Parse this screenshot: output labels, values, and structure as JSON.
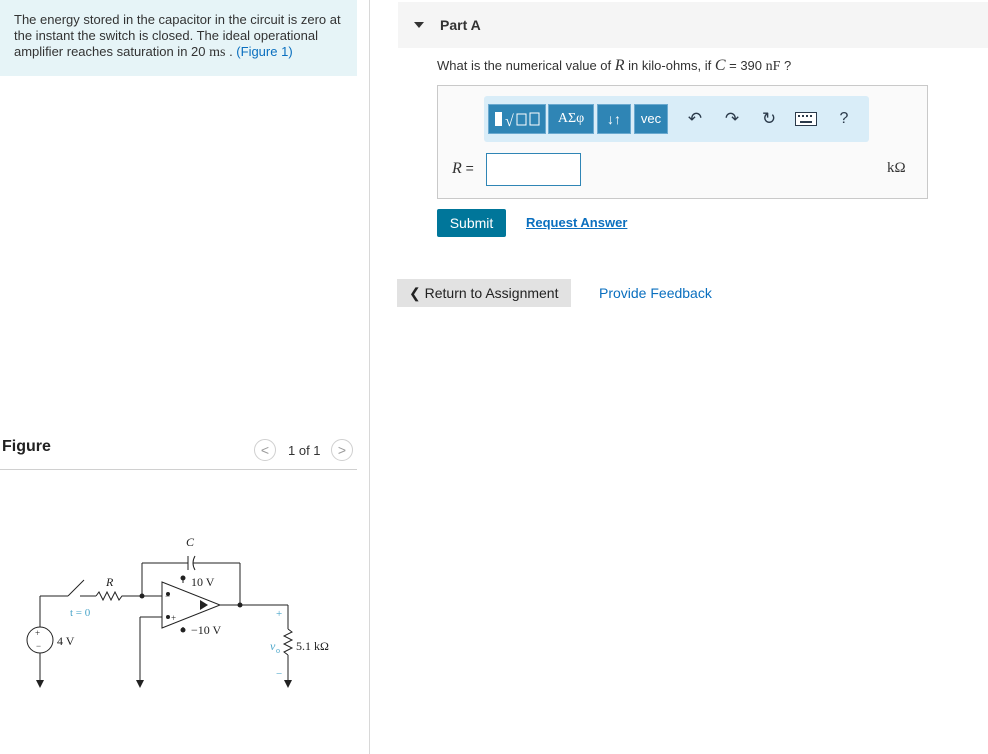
{
  "problem": {
    "text_before_math": "The energy stored in the capacitor in the circuit is zero at the instant the switch is closed. The ideal operational amplifier reaches saturation in 20 ",
    "math_unit": "ms",
    "text_after_math": " . ",
    "figure_link": "(Figure 1)"
  },
  "figure": {
    "title": "Figure",
    "counter": "1 of 1",
    "prev_glyph": "<",
    "next_glyph": ">",
    "circuit": {
      "capacitor_label": "C",
      "resistor_label": "R",
      "switch_label": "t = 0",
      "source_label": "4 V",
      "supply_pos": "10 V",
      "supply_neg": "−10 V",
      "output_label": "v",
      "output_sub": "o",
      "load_label": "5.1 kΩ",
      "plus": "+",
      "minus": "−"
    }
  },
  "part": {
    "title": "Part A",
    "question_prefix": "What is the numerical value of ",
    "question_var": "R",
    "question_mid": " in kilo-ohms, if ",
    "question_var2": "C",
    "question_eq": " = 390 ",
    "question_unit": "nF",
    "question_suffix": " ?"
  },
  "toolbar": {
    "template_icon": "template-icon",
    "greek_label": "ΑΣφ",
    "arrows_label": "↓↑",
    "vec_label": "vec",
    "undo_icon": "undo-icon",
    "redo_icon": "redo-icon",
    "reset_icon": "reset-icon",
    "keyboard_icon": "keyboard-icon",
    "help_label": "?"
  },
  "answer": {
    "var_label": "R",
    "equals": " =",
    "value": "",
    "unit": "kΩ"
  },
  "actions": {
    "submit": "Submit",
    "request": "Request Answer",
    "return": "Return to Assignment",
    "feedback": "Provide Feedback"
  },
  "colors": {
    "problem_bg": "#e6f4f7",
    "toolbar_bg": "#d9edf8",
    "toolbar_btn": "#2f85b5",
    "submit_bg": "#00769a",
    "link": "#0a6fbf"
  }
}
